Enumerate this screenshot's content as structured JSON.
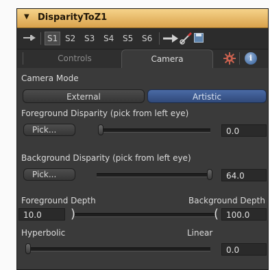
{
  "panel": {
    "title": "DisparityToZ1"
  },
  "view_slots": [
    "S1",
    "S2",
    "S3",
    "S4",
    "S5",
    "S6"
  ],
  "tabs": {
    "controls": "Controls",
    "camera": "Camera",
    "active": "Camera"
  },
  "camera_mode": {
    "label": "Camera Mode",
    "options": [
      "External",
      "Artistic"
    ],
    "selected": "Artistic"
  },
  "foreground_disparity": {
    "label": "Foreground Disparity (pick from left eye)",
    "pick_label": "Pick...",
    "value": "0.0"
  },
  "background_disparity": {
    "label": "Background Disparity (pick from left eye)",
    "pick_label": "Pick...",
    "value": "64.0"
  },
  "depth_range": {
    "foreground_label": "Foreground Depth",
    "background_label": "Background Depth",
    "foreground_value": "10.0",
    "background_value": "100.0"
  },
  "falloff": {
    "left_label": "Hyperbolic",
    "right_label": "Linear",
    "value": "0.0"
  },
  "icons": [
    "pin-icon",
    "arrow-right-icon",
    "wand-icon",
    "save-icon",
    "gear-icon",
    "info-icon",
    "collapse-triangle-icon"
  ],
  "colors": {
    "titlebar": "#e8b96a",
    "panel_bg": "#3a3a3a",
    "selected_button": "#3d5a92"
  }
}
